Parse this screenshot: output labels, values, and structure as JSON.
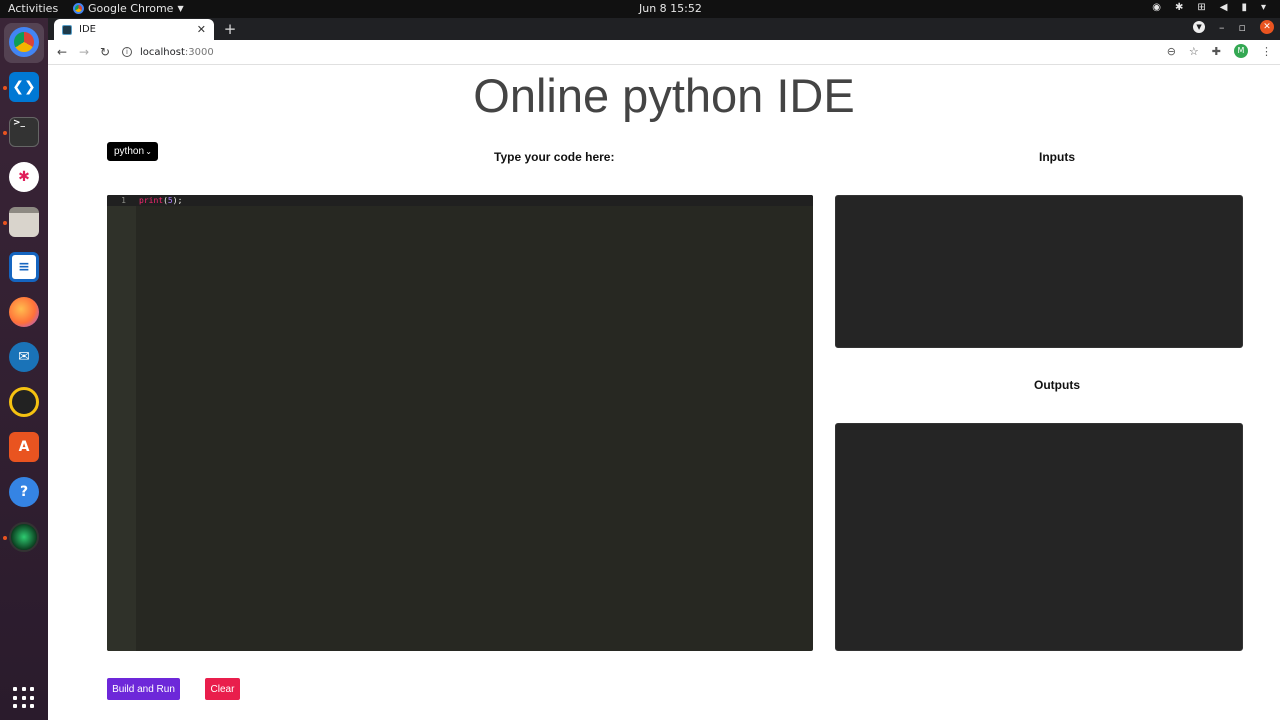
{
  "topbar": {
    "activities": "Activities",
    "app_name": "Google Chrome",
    "clock": "Jun 8  15:52"
  },
  "browser": {
    "tab_title": "IDE",
    "url_host": "localhost",
    "url_port": ":3000",
    "profile_initial": "M"
  },
  "page": {
    "title": "Online python IDE",
    "language_selected": "python",
    "code_label": "Type your code here:",
    "inputs_label": "Inputs",
    "outputs_label": "Outputs",
    "editor": {
      "line_number": "1",
      "code_fn": "print",
      "code_open": "(",
      "code_arg": "5",
      "code_close": ");"
    },
    "run_button": "Build and Run",
    "clear_button": "Clear"
  },
  "colors": {
    "run_button": "#6d28d9",
    "clear_button": "#e91e4c",
    "editor_bg": "#272822",
    "panel_bg": "#252525"
  }
}
